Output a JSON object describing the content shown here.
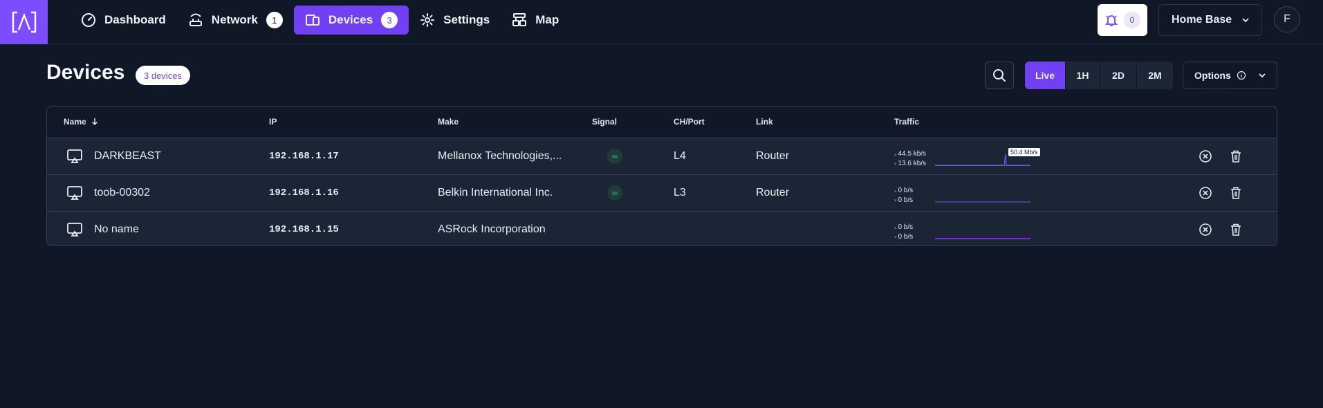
{
  "nav": {
    "items": [
      {
        "label": "Dashboard",
        "icon": "gauge-icon"
      },
      {
        "label": "Network",
        "icon": "router-icon",
        "badge": "1"
      },
      {
        "label": "Devices",
        "icon": "devices-icon",
        "badge": "3",
        "active": true
      },
      {
        "label": "Settings",
        "icon": "gear-icon"
      },
      {
        "label": "Map",
        "icon": "map-icon"
      }
    ],
    "notification_count": "0",
    "site_name": "Home Base",
    "avatar_initial": "F"
  },
  "page": {
    "title": "Devices",
    "device_count": "3 devices",
    "ranges": [
      "Live",
      "1H",
      "2D",
      "2M"
    ],
    "active_range": "Live",
    "options_label": "Options"
  },
  "table": {
    "headers": {
      "name": "Name",
      "ip": "IP",
      "make": "Make",
      "signal": "Signal",
      "port": "CH/Port",
      "link": "Link",
      "traffic": "Traffic"
    },
    "rows": [
      {
        "name": "DARKBEAST",
        "ip": "192.168.1.17",
        "make": "Mellanox Technologies,...",
        "has_signal": true,
        "port": "L4",
        "link": "Router",
        "up": "44.5 kb/s",
        "down": "13.6 kb/s",
        "peak": "50.4 Mb/s"
      },
      {
        "name": "toob-00302",
        "ip": "192.168.1.16",
        "make": "Belkin International Inc.",
        "has_signal": true,
        "port": "L3",
        "link": "Router",
        "up": "0 b/s",
        "down": "0 b/s"
      },
      {
        "name": "No name",
        "ip": "192.168.1.15",
        "make": "ASRock Incorporation",
        "has_signal": false,
        "port": "",
        "link": "",
        "up": "0 b/s",
        "down": "0 b/s"
      }
    ]
  },
  "colors": {
    "accent": "#7040f2",
    "background": "#101827",
    "row_background": "#1b2535"
  }
}
